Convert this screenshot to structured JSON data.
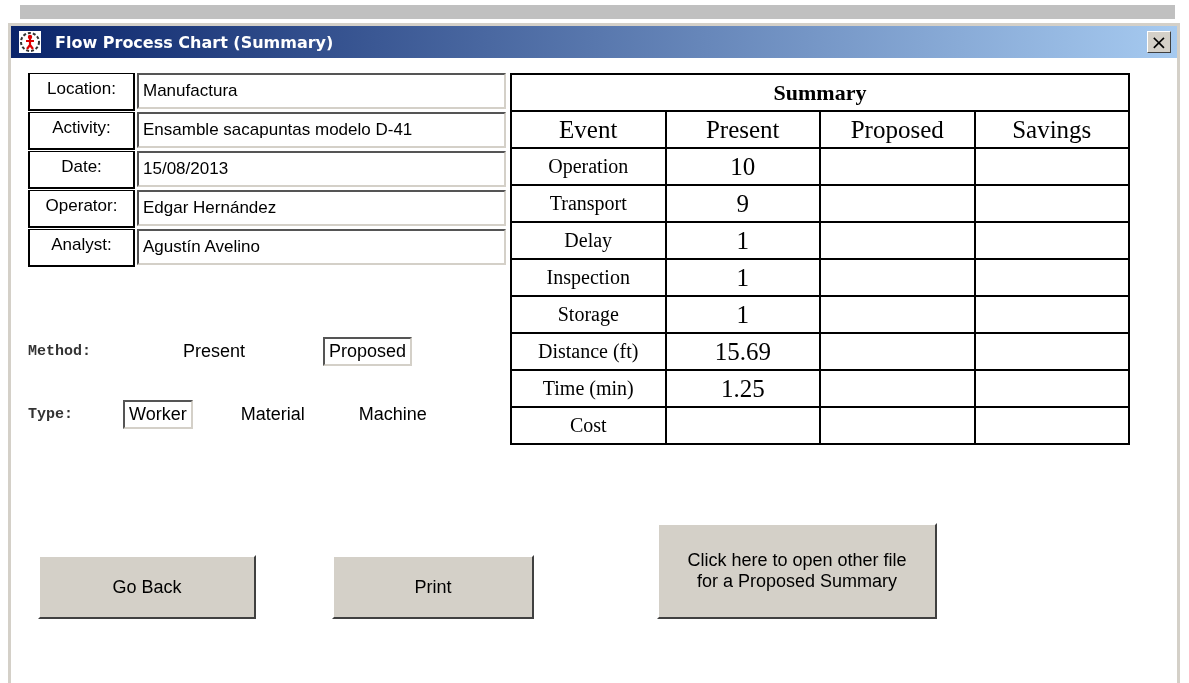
{
  "window": {
    "title": "Flow Process Chart (Summary)",
    "close": "×"
  },
  "fields": [
    {
      "label": "Location:",
      "value": "Manufactura"
    },
    {
      "label": "Activity:",
      "value": "Ensamble sacapuntas modelo D-41"
    },
    {
      "label": "Date:",
      "value": "15/08/2013"
    },
    {
      "label": "Operator:",
      "value": "Edgar Hernández"
    },
    {
      "label": "Analyst:",
      "value": "Agustín Avelino"
    }
  ],
  "method": {
    "label": "Method:",
    "options": [
      {
        "label": "Present",
        "selected": false
      },
      {
        "label": "Proposed",
        "selected": true
      }
    ]
  },
  "type": {
    "label": "Type:",
    "options": [
      {
        "label": "Worker",
        "selected": true
      },
      {
        "label": "Material",
        "selected": false
      },
      {
        "label": "Machine",
        "selected": false
      }
    ]
  },
  "summary": {
    "title": "Summary",
    "columns": [
      "Event",
      "Present",
      "Proposed",
      "Savings"
    ],
    "rows": [
      {
        "event": "Operation",
        "present": "10"
      },
      {
        "event": "Transport",
        "present": "9"
      },
      {
        "event": "Delay",
        "present": "1"
      },
      {
        "event": "Inspection",
        "present": "1"
      },
      {
        "event": "Storage",
        "present": "1"
      },
      {
        "event": "Distance (ft)",
        "present": "15.69"
      },
      {
        "event": "Time (min)",
        "present": "1.25"
      },
      {
        "event": "Cost"
      }
    ]
  },
  "buttons": [
    "Go Back",
    "Print",
    "Click here to open other file for a Proposed Summary"
  ]
}
